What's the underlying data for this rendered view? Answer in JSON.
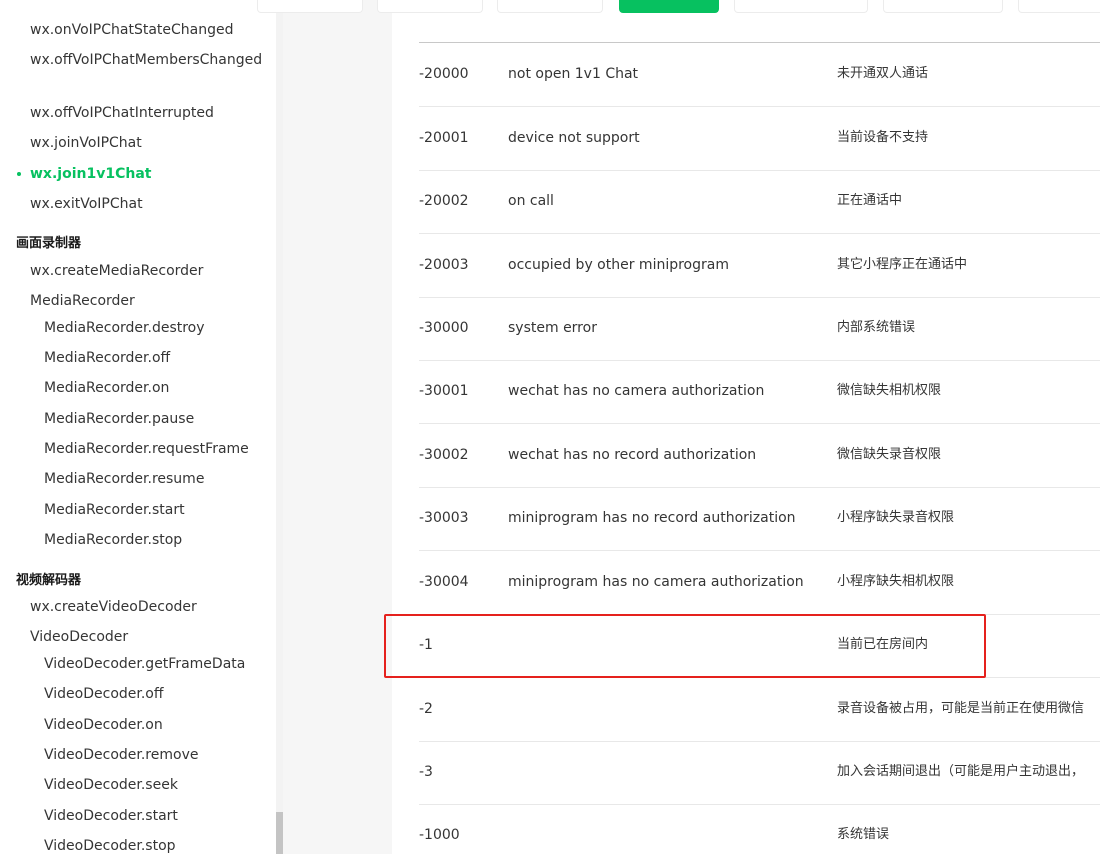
{
  "sidebar": {
    "cut_item": "wx.onVoIPChatStateChanged",
    "items_top": [
      {
        "label": "wx.offVoIPChatMembersChanged",
        "active": false
      },
      {
        "label": "wx.offVoIPChatInterrupted",
        "active": false
      },
      {
        "label": "wx.joinVoIPChat",
        "active": false
      },
      {
        "label": "wx.join1v1Chat",
        "active": true
      },
      {
        "label": "wx.exitVoIPChat",
        "active": false
      }
    ],
    "section_media_recorder": "画面录制器",
    "media_recorder_items": [
      "wx.createMediaRecorder",
      "MediaRecorder"
    ],
    "media_recorder_methods": [
      "MediaRecorder.destroy",
      "MediaRecorder.off",
      "MediaRecorder.on",
      "MediaRecorder.pause",
      "MediaRecorder.requestFrame",
      "MediaRecorder.resume",
      "MediaRecorder.start",
      "MediaRecorder.stop"
    ],
    "section_video_decoder": "视频解码器",
    "video_decoder_items": [
      "wx.createVideoDecoder",
      "VideoDecoder"
    ],
    "video_decoder_methods": [
      "VideoDecoder.getFrameData",
      "VideoDecoder.off",
      "VideoDecoder.on",
      "VideoDecoder.remove",
      "VideoDecoder.seek",
      "VideoDecoder.start",
      "VideoDecoder.stop"
    ]
  },
  "table": {
    "rows": [
      {
        "code": "-20000",
        "message": "not open 1v1 Chat",
        "description": "未开通双人通话"
      },
      {
        "code": "-20001",
        "message": "device not support",
        "description": "当前设备不支持"
      },
      {
        "code": "-20002",
        "message": "on call",
        "description": "正在通话中"
      },
      {
        "code": "-20003",
        "message": "occupied by other miniprogram",
        "description": "其它小程序正在通话中"
      },
      {
        "code": "-30000",
        "message": "system error",
        "description": "内部系统错误"
      },
      {
        "code": "-30001",
        "message": "wechat has no camera authorization",
        "description": "微信缺失相机权限"
      },
      {
        "code": "-30002",
        "message": "wechat has no record authorization",
        "description": "微信缺失录音权限"
      },
      {
        "code": "-30003",
        "message": "miniprogram has no record authorization",
        "description": "小程序缺失录音权限"
      },
      {
        "code": "-30004",
        "message": "miniprogram has no camera authorization",
        "description": "小程序缺失相机权限"
      },
      {
        "code": "-1",
        "message": "",
        "description": "当前已在房间内"
      },
      {
        "code": "-2",
        "message": "",
        "description": "录音设备被占用，可能是当前正在使用微信"
      },
      {
        "code": "-3",
        "message": "",
        "description": "加入会话期间退出（可能是用户主动退出，"
      },
      {
        "code": "-1000",
        "message": "",
        "description": "系统错误"
      }
    ]
  },
  "colors": {
    "accent": "#07c160",
    "highlight_border": "#e5211d"
  }
}
